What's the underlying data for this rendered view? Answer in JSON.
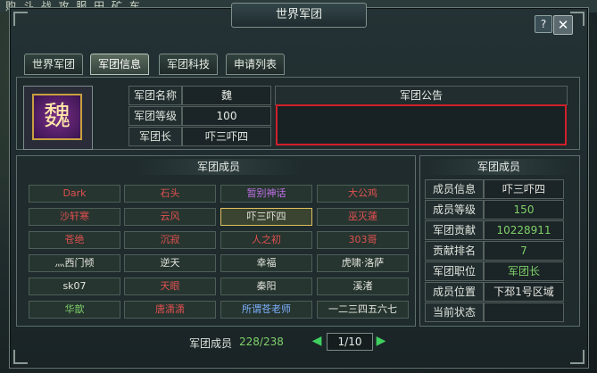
{
  "background_text": "购 斗 战 攻 服 田 矿 车",
  "window": {
    "title": "世界军团",
    "help_label": "?",
    "close_label": "✕"
  },
  "tabs": [
    {
      "label": "世界军团",
      "active": false
    },
    {
      "label": "军团信息",
      "active": true
    },
    {
      "label": "军团科技",
      "active": false
    },
    {
      "label": "申请列表",
      "active": false
    }
  ],
  "emblem": {
    "char": "魏"
  },
  "legion_info": {
    "name_label": "军团名称",
    "name_value": "魏",
    "level_label": "军团等级",
    "level_value": "100",
    "leader_label": "军团长",
    "leader_value": "吓三吓四"
  },
  "notice": {
    "header": "军团公告",
    "content": ""
  },
  "members_section": {
    "title": "军团成员",
    "members": [
      {
        "name": "Dark",
        "color": "red"
      },
      {
        "name": "石头",
        "color": "red"
      },
      {
        "name": "暂别神话",
        "color": "purple"
      },
      {
        "name": "大公鸡",
        "color": "red"
      },
      {
        "name": "沙轩寒",
        "color": "red"
      },
      {
        "name": "云风",
        "color": "red"
      },
      {
        "name": "吓三吓四",
        "color": "white",
        "selected": true
      },
      {
        "name": "巫灭蓮",
        "color": "red"
      },
      {
        "name": "苍绝",
        "color": "red"
      },
      {
        "name": "沉寂",
        "color": "red"
      },
      {
        "name": "人之初",
        "color": "red"
      },
      {
        "name": "303哥",
        "color": "red"
      },
      {
        "name": "灬西门倾",
        "color": "white"
      },
      {
        "name": "逆天",
        "color": "white"
      },
      {
        "name": "幸福",
        "color": "white"
      },
      {
        "name": "虎啸·洛萨",
        "color": "white"
      },
      {
        "name": "sk07",
        "color": "white"
      },
      {
        "name": "天眼",
        "color": "red"
      },
      {
        "name": "秦阳",
        "color": "white"
      },
      {
        "name": "溪渚",
        "color": "white"
      },
      {
        "name": "华歆",
        "color": "green"
      },
      {
        "name": "唐潇潇",
        "color": "red"
      },
      {
        "name": "所谓苍老师",
        "color": "blue"
      },
      {
        "name": "一二三四五六七",
        "color": "white"
      }
    ],
    "footer_label": "军团成员",
    "footer_count": "228/238",
    "page": "1/10"
  },
  "member_detail": {
    "title": "军团成员",
    "rows": [
      {
        "label": "成员信息",
        "value": "吓三吓四",
        "color": "white"
      },
      {
        "label": "成员等级",
        "value": "150",
        "color": "green"
      },
      {
        "label": "军团贡献",
        "value": "10228911",
        "color": "green"
      },
      {
        "label": "贡献排名",
        "value": "7",
        "color": "green"
      },
      {
        "label": "军团职位",
        "value": "军团长",
        "color": "green"
      },
      {
        "label": "成员位置",
        "value": "下邳1号区域",
        "color": "white"
      },
      {
        "label": "当前状态",
        "value": "",
        "color": "white"
      }
    ]
  },
  "colors": {
    "highlight_border": "#d0202a",
    "accent_green": "#7fd06a",
    "name_red": "#e05050"
  }
}
